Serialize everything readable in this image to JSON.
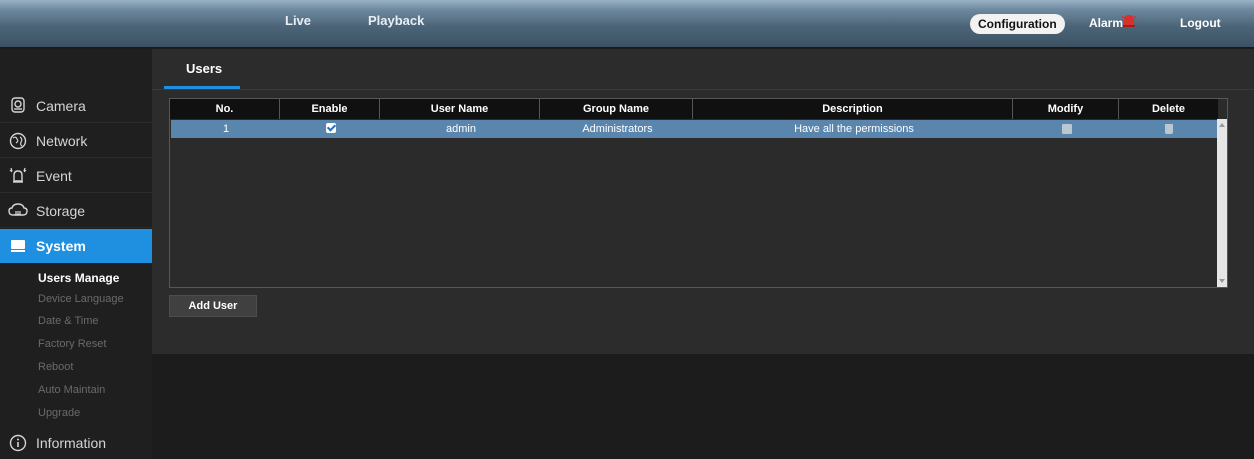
{
  "topnav": {
    "live": "Live",
    "playback": "Playback",
    "configuration": "Configuration",
    "alarm": "Alarm",
    "logout": "Logout"
  },
  "sidebar": {
    "items": [
      {
        "label": "Camera",
        "icon": "camera-icon"
      },
      {
        "label": "Network",
        "icon": "network-icon"
      },
      {
        "label": "Event",
        "icon": "event-icon"
      },
      {
        "label": "Storage",
        "icon": "storage-icon"
      },
      {
        "label": "System",
        "icon": "system-icon",
        "active": true
      },
      {
        "label": "Information",
        "icon": "info-icon"
      }
    ],
    "system_subitems": [
      {
        "label": "Users Manage",
        "current": true
      },
      {
        "label": "Device Language"
      },
      {
        "label": "Date & Time"
      },
      {
        "label": "Factory Reset"
      },
      {
        "label": "Reboot"
      },
      {
        "label": "Auto Maintain"
      },
      {
        "label": "Upgrade"
      }
    ]
  },
  "main": {
    "tab": "Users",
    "table": {
      "headers": [
        "No.",
        "Enable",
        "User Name",
        "Group Name",
        "Description",
        "Modify",
        "Delete"
      ],
      "rows": [
        {
          "no": "1",
          "enable": true,
          "user_name": "admin",
          "group_name": "Administrators",
          "description": "Have all the permissions"
        }
      ]
    },
    "add_user": "Add User"
  },
  "colors": {
    "accent": "#1f8fe0",
    "selected_row": "#5a86ad",
    "alarm_icon": "#d9302b"
  }
}
